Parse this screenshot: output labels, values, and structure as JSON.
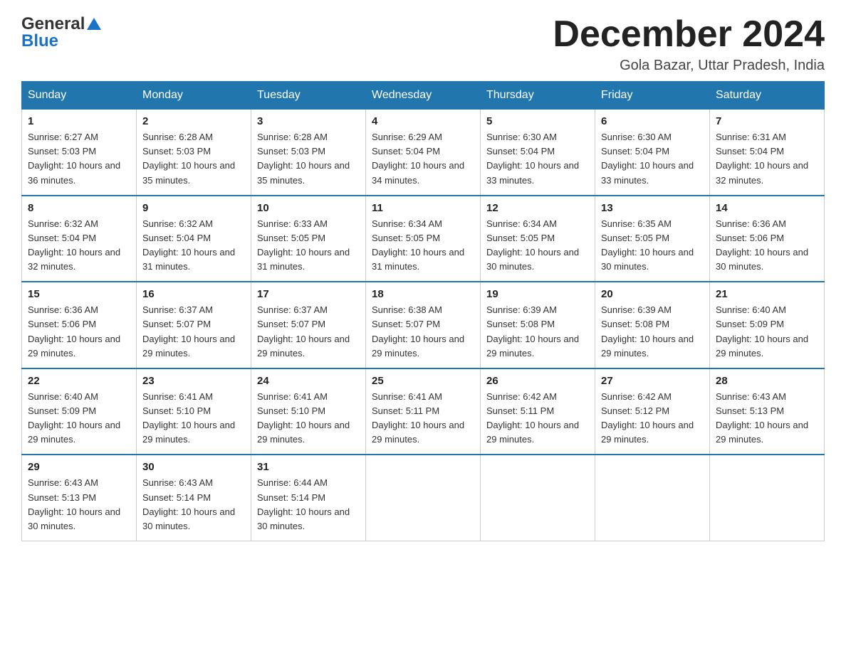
{
  "header": {
    "logo_general": "General",
    "logo_blue": "Blue",
    "month_year": "December 2024",
    "location": "Gola Bazar, Uttar Pradesh, India"
  },
  "weekdays": [
    "Sunday",
    "Monday",
    "Tuesday",
    "Wednesday",
    "Thursday",
    "Friday",
    "Saturday"
  ],
  "weeks": [
    [
      {
        "day": "1",
        "sunrise": "6:27 AM",
        "sunset": "5:03 PM",
        "daylight": "10 hours and 36 minutes."
      },
      {
        "day": "2",
        "sunrise": "6:28 AM",
        "sunset": "5:03 PM",
        "daylight": "10 hours and 35 minutes."
      },
      {
        "day": "3",
        "sunrise": "6:28 AM",
        "sunset": "5:03 PM",
        "daylight": "10 hours and 35 minutes."
      },
      {
        "day": "4",
        "sunrise": "6:29 AM",
        "sunset": "5:04 PM",
        "daylight": "10 hours and 34 minutes."
      },
      {
        "day": "5",
        "sunrise": "6:30 AM",
        "sunset": "5:04 PM",
        "daylight": "10 hours and 33 minutes."
      },
      {
        "day": "6",
        "sunrise": "6:30 AM",
        "sunset": "5:04 PM",
        "daylight": "10 hours and 33 minutes."
      },
      {
        "day": "7",
        "sunrise": "6:31 AM",
        "sunset": "5:04 PM",
        "daylight": "10 hours and 32 minutes."
      }
    ],
    [
      {
        "day": "8",
        "sunrise": "6:32 AM",
        "sunset": "5:04 PM",
        "daylight": "10 hours and 32 minutes."
      },
      {
        "day": "9",
        "sunrise": "6:32 AM",
        "sunset": "5:04 PM",
        "daylight": "10 hours and 31 minutes."
      },
      {
        "day": "10",
        "sunrise": "6:33 AM",
        "sunset": "5:05 PM",
        "daylight": "10 hours and 31 minutes."
      },
      {
        "day": "11",
        "sunrise": "6:34 AM",
        "sunset": "5:05 PM",
        "daylight": "10 hours and 31 minutes."
      },
      {
        "day": "12",
        "sunrise": "6:34 AM",
        "sunset": "5:05 PM",
        "daylight": "10 hours and 30 minutes."
      },
      {
        "day": "13",
        "sunrise": "6:35 AM",
        "sunset": "5:05 PM",
        "daylight": "10 hours and 30 minutes."
      },
      {
        "day": "14",
        "sunrise": "6:36 AM",
        "sunset": "5:06 PM",
        "daylight": "10 hours and 30 minutes."
      }
    ],
    [
      {
        "day": "15",
        "sunrise": "6:36 AM",
        "sunset": "5:06 PM",
        "daylight": "10 hours and 29 minutes."
      },
      {
        "day": "16",
        "sunrise": "6:37 AM",
        "sunset": "5:07 PM",
        "daylight": "10 hours and 29 minutes."
      },
      {
        "day": "17",
        "sunrise": "6:37 AM",
        "sunset": "5:07 PM",
        "daylight": "10 hours and 29 minutes."
      },
      {
        "day": "18",
        "sunrise": "6:38 AM",
        "sunset": "5:07 PM",
        "daylight": "10 hours and 29 minutes."
      },
      {
        "day": "19",
        "sunrise": "6:39 AM",
        "sunset": "5:08 PM",
        "daylight": "10 hours and 29 minutes."
      },
      {
        "day": "20",
        "sunrise": "6:39 AM",
        "sunset": "5:08 PM",
        "daylight": "10 hours and 29 minutes."
      },
      {
        "day": "21",
        "sunrise": "6:40 AM",
        "sunset": "5:09 PM",
        "daylight": "10 hours and 29 minutes."
      }
    ],
    [
      {
        "day": "22",
        "sunrise": "6:40 AM",
        "sunset": "5:09 PM",
        "daylight": "10 hours and 29 minutes."
      },
      {
        "day": "23",
        "sunrise": "6:41 AM",
        "sunset": "5:10 PM",
        "daylight": "10 hours and 29 minutes."
      },
      {
        "day": "24",
        "sunrise": "6:41 AM",
        "sunset": "5:10 PM",
        "daylight": "10 hours and 29 minutes."
      },
      {
        "day": "25",
        "sunrise": "6:41 AM",
        "sunset": "5:11 PM",
        "daylight": "10 hours and 29 minutes."
      },
      {
        "day": "26",
        "sunrise": "6:42 AM",
        "sunset": "5:11 PM",
        "daylight": "10 hours and 29 minutes."
      },
      {
        "day": "27",
        "sunrise": "6:42 AM",
        "sunset": "5:12 PM",
        "daylight": "10 hours and 29 minutes."
      },
      {
        "day": "28",
        "sunrise": "6:43 AM",
        "sunset": "5:13 PM",
        "daylight": "10 hours and 29 minutes."
      }
    ],
    [
      {
        "day": "29",
        "sunrise": "6:43 AM",
        "sunset": "5:13 PM",
        "daylight": "10 hours and 30 minutes."
      },
      {
        "day": "30",
        "sunrise": "6:43 AM",
        "sunset": "5:14 PM",
        "daylight": "10 hours and 30 minutes."
      },
      {
        "day": "31",
        "sunrise": "6:44 AM",
        "sunset": "5:14 PM",
        "daylight": "10 hours and 30 minutes."
      },
      null,
      null,
      null,
      null
    ]
  ],
  "labels": {
    "sunrise": "Sunrise:",
    "sunset": "Sunset:",
    "daylight": "Daylight:"
  }
}
